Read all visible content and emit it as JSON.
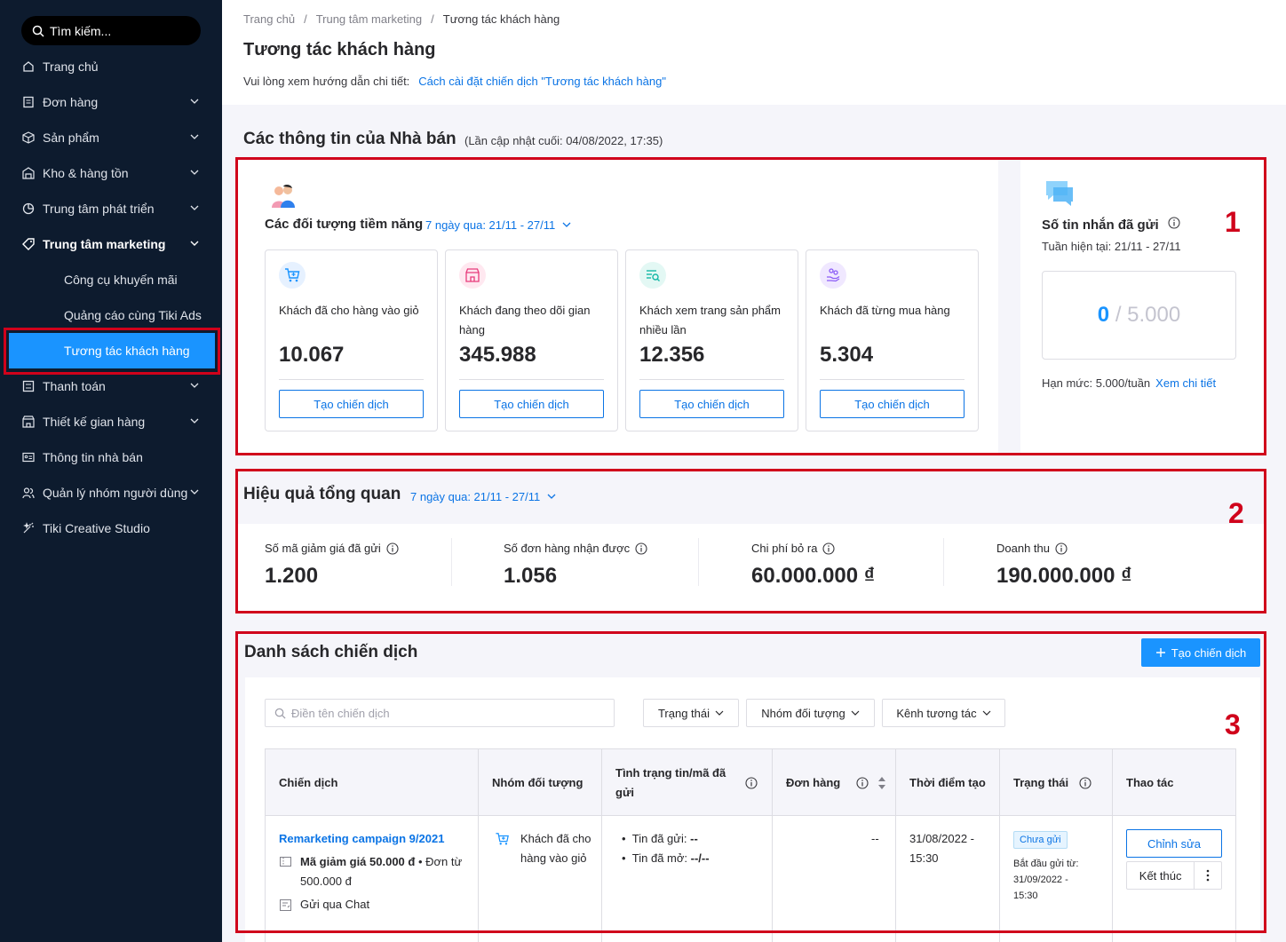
{
  "sidebar": {
    "search_placeholder": "Tìm kiếm...",
    "items": [
      {
        "label": "Trang chủ"
      },
      {
        "label": "Đơn hàng"
      },
      {
        "label": "Sản phẩm"
      },
      {
        "label": "Kho & hàng tồn"
      },
      {
        "label": "Trung tâm phát triển"
      },
      {
        "label": "Trung tâm marketing"
      },
      {
        "label": "Công cụ khuyến mãi"
      },
      {
        "label": "Quảng cáo cùng Tiki Ads"
      },
      {
        "label": "Tương tác khách hàng"
      },
      {
        "label": "Thanh toán"
      },
      {
        "label": "Thiết kế gian hàng"
      },
      {
        "label": "Thông tin nhà bán"
      },
      {
        "label": "Quản lý nhóm người dùng"
      },
      {
        "label": "Tiki Creative Studio"
      }
    ]
  },
  "breadcrumb": [
    "Trang chủ",
    "Trung tâm marketing",
    "Tương tác khách hàng"
  ],
  "page_title": "Tương tác khách hàng",
  "guide": {
    "text": "Vui lòng xem hướng dẫn chi tiết:",
    "link": "Cách cài đặt chiến dịch \"Tương tác khách hàng\""
  },
  "seller_info": {
    "title": "Các thông tin của Nhà bán",
    "updated": "(Lần cập nhật cuối: 04/08/2022, 17:35)"
  },
  "audience": {
    "title": "Các đối tượng tiềm năng",
    "date_range": "7 ngày qua: 21/11 - 27/11",
    "cards": [
      {
        "label": "Khách đã cho hàng vào giỏ",
        "value": "10.067",
        "button": "Tạo chiến dịch"
      },
      {
        "label": "Khách đang theo dõi gian hàng",
        "value": "345.988",
        "button": "Tạo chiến dịch"
      },
      {
        "label": "Khách xem trang sản phẩm nhiều lần",
        "value": "12.356",
        "button": "Tạo chiến dịch"
      },
      {
        "label": "Khách đã từng mua hàng",
        "value": "5.304",
        "button": "Tạo chiến dịch"
      }
    ]
  },
  "messages": {
    "title": "Số tin nhắn đã gửi",
    "week": "Tuần hiện tại: 21/11 - 27/11",
    "used": "0",
    "total": "/ 5.000",
    "limit": "Hạn mức: 5.000/tuần",
    "detail_link": "Xem chi tiết"
  },
  "performance": {
    "title": "Hiệu quả tổng quan",
    "date_range": "7 ngày qua: 21/11 - 27/11",
    "metrics": [
      {
        "label": "Số mã giảm giá đã gửi",
        "value": "1.200"
      },
      {
        "label": "Số đơn hàng nhận được",
        "value": "1.056"
      },
      {
        "label": "Chi phí bỏ ra",
        "value": "60.000.000 ₫"
      },
      {
        "label": "Doanh thu",
        "value": "190.000.000 ₫"
      }
    ]
  },
  "campaigns": {
    "title": "Danh sách chiến dịch",
    "create_button": "Tạo chiến dịch",
    "search_placeholder": "Điền tên chiến dịch",
    "filters": [
      "Trạng thái",
      "Nhóm đối tượng",
      "Kênh tương tác"
    ],
    "columns": [
      "Chiến dịch",
      "Nhóm đối tượng",
      "Tình trạng tin/mã đã gửi",
      "Đơn hàng",
      "Thời điểm tạo",
      "Trạng thái",
      "Thao tác"
    ],
    "rows": [
      {
        "name": "Remarketing campaign 9/2021",
        "discount": "Mã giảm giá 50.000 đ",
        "discount_min": "• Đơn từ 500.000 đ",
        "channel": "Gửi qua Chat",
        "audience": "Khách đã cho hàng vào giỏ",
        "sent_label": "Tin đã gửi:",
        "sent_value": "--",
        "opened_label": "Tin đã mở:",
        "opened_value": "--/--",
        "orders": "--",
        "created": "31/08/2022 - 15:30",
        "status": "Chưa gửi",
        "start": "Bắt đầu gửi từ: 31/09/2022 - 15:30",
        "edit": "Chỉnh sửa",
        "end": "Kết thúc"
      }
    ]
  },
  "annotations": [
    "1",
    "2",
    "3"
  ],
  "colors": {
    "sidebar_bg": "#0d1b2e",
    "primary": "#1a94ff",
    "link": "#0b74e5",
    "highlight": "#d0021b"
  }
}
